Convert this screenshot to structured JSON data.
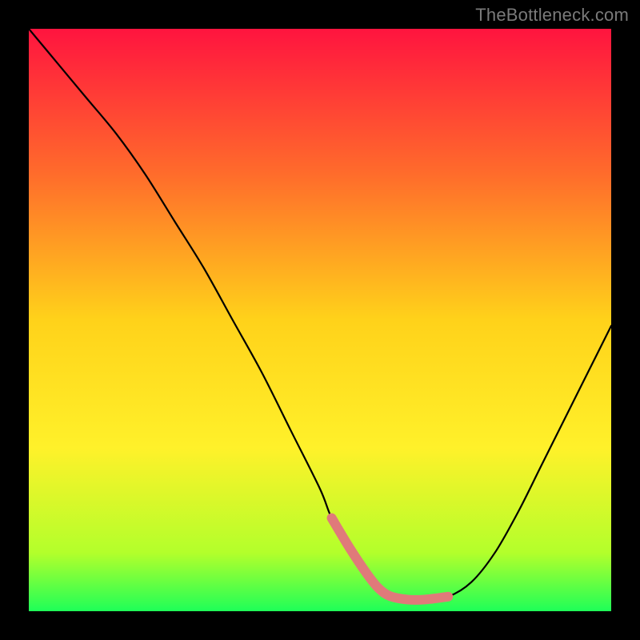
{
  "watermark": "TheBottleneck.com",
  "chart_data": {
    "type": "line",
    "title": "",
    "xlabel": "",
    "ylabel": "",
    "xlim": [
      0,
      100
    ],
    "ylim": [
      0,
      100
    ],
    "gradient_stops": [
      {
        "offset": 0,
        "color": "#ff143f"
      },
      {
        "offset": 25,
        "color": "#ff6c2b"
      },
      {
        "offset": 50,
        "color": "#ffd21a"
      },
      {
        "offset": 72,
        "color": "#fff12a"
      },
      {
        "offset": 90,
        "color": "#b3ff2b"
      },
      {
        "offset": 100,
        "color": "#1eff58"
      }
    ],
    "series": [
      {
        "name": "bottleneck-curve",
        "color": "#000000",
        "x": [
          0,
          5,
          10,
          15,
          20,
          25,
          30,
          35,
          40,
          45,
          50,
          52,
          55,
          58,
          60,
          62,
          65,
          68,
          72,
          76,
          80,
          84,
          88,
          92,
          96,
          100
        ],
        "values": [
          100,
          94,
          88,
          82,
          75,
          67,
          59,
          50,
          41,
          31,
          21,
          16,
          11,
          6.5,
          4.0,
          2.6,
          2.0,
          2.0,
          2.5,
          5.0,
          10,
          17,
          25,
          33,
          41,
          49
        ]
      }
    ],
    "highlight": {
      "name": "optimal-zone",
      "color": "#e07a7a",
      "x": [
        52,
        55,
        58,
        60,
        62,
        65,
        68,
        72
      ],
      "values": [
        16,
        11,
        6.5,
        4.0,
        2.6,
        2.0,
        2.0,
        2.5
      ]
    }
  }
}
